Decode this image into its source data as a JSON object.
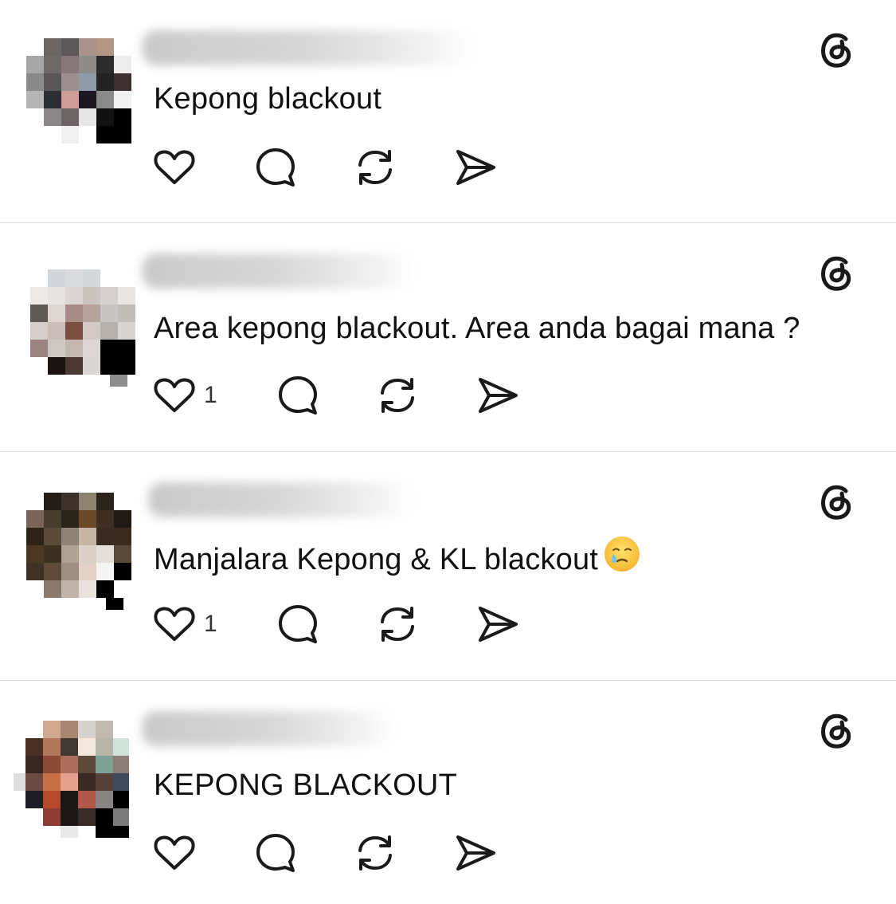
{
  "feed": {
    "posts": [
      {
        "username": "",
        "text": "Kepong blackout",
        "like_count": "",
        "emoji": ""
      },
      {
        "username": "",
        "text": "Area kepong blackout. Area anda bagai mana ?",
        "like_count": "1",
        "emoji": ""
      },
      {
        "username": "",
        "text": "Manjalara Kepong & KL blackout",
        "like_count": "1",
        "emoji": "face-holding-back-tears"
      },
      {
        "username": "",
        "text": "KEPONG BLACKOUT",
        "like_count": "",
        "emoji": ""
      }
    ]
  },
  "icons": {
    "app_logo": "threads-logo-icon",
    "like": "heart-icon",
    "reply": "comment-bubble-icon",
    "repost": "repost-icon",
    "share": "send-icon"
  },
  "colors": {
    "icon_stroke": "#1a1a1a",
    "divider": "#dcdcdc",
    "count_text": "#333333"
  }
}
